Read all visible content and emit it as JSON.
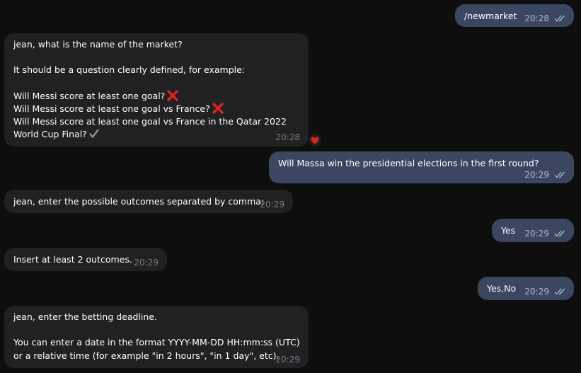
{
  "messages": [
    {
      "dir": "out",
      "text": "/newmarket",
      "time": "20:28",
      "read": true
    },
    {
      "dir": "in",
      "text": "jean, what is the name of the market?\n\nIt should be a question clearly defined, for example:\n\nWill Messi score at least one goal? \nWill Messi score at least one goal vs France? \nWill Messi score at least one goal vs France in the Qatar 2022 World Cup Final? ",
      "time": "20:28",
      "reaction": "heart"
    },
    {
      "dir": "out",
      "text": "Will Massa win the presidential elections in the first round?",
      "time": "20:29",
      "read": true
    },
    {
      "dir": "in",
      "text": "jean, enter the possible outcomes separated by comma:",
      "time": "20:29"
    },
    {
      "dir": "out",
      "text": "Yes",
      "time": "20:29",
      "read": true
    },
    {
      "dir": "in",
      "text": "Insert at least 2 outcomes.",
      "time": "20:29"
    },
    {
      "dir": "out",
      "text": "Yes,No",
      "time": "20:29",
      "read": true
    },
    {
      "dir": "in",
      "text": "jean, enter the betting deadline.\n\nYou can enter a date in the format YYYY-MM-DD HH:mm:ss (UTC)\nor a relative time (for example \"in 2 hours\", \"in 1 day\", etc).",
      "time": "20:29"
    }
  ],
  "example_lines": [
    "Will Messi score at least one goal?",
    "Will Messi score at least one goal vs France?",
    "Will Messi score at least one goal vs France in the Qatar 2022",
    "World Cup Final?"
  ],
  "msg1_intro": "jean, what is the name of the market?",
  "msg1_hint": "It should be a question clearly defined, for example:",
  "msg8_line1": "jean, enter the betting deadline.",
  "msg8_line2": "You can enter a date in the format YYYY-MM-DD HH:mm:ss (UTC)",
  "msg8_line3": "or a relative time (for example \"in 2 hours\", \"in 1 day\", etc).",
  "icons": {
    "wrong": "red-cross-icon",
    "right": "check-mark-icon",
    "read": "double-check-icon",
    "reaction": "heart-icon"
  },
  "colors": {
    "background": "#0e0e0f",
    "incoming": "#212124",
    "outgoing": "#3b4760",
    "cross": "#e0241b",
    "heart": "#e0241b"
  }
}
